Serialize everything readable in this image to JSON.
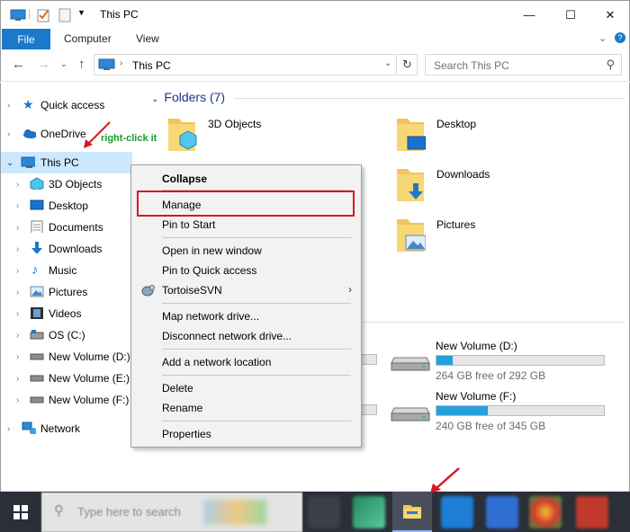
{
  "window": {
    "title": "This PC",
    "controls": {
      "minimize": "—",
      "maximize": "☐",
      "close": "✕"
    }
  },
  "ribbon": {
    "tabs": [
      "File",
      "Computer",
      "View"
    ],
    "collapse_chevron": "⌄",
    "help": "?"
  },
  "address": {
    "path": "This PC",
    "search_placeholder": "Search This PC"
  },
  "navigation": {
    "quick_access": "Quick access",
    "onedrive": "OneDrive",
    "this_pc": "This PC",
    "children": [
      {
        "label": "3D Objects",
        "icon": "3d-objects-icon"
      },
      {
        "label": "Desktop",
        "icon": "desktop-icon"
      },
      {
        "label": "Documents",
        "icon": "documents-icon"
      },
      {
        "label": "Downloads",
        "icon": "downloads-icon"
      },
      {
        "label": "Music",
        "icon": "music-icon"
      },
      {
        "label": "Pictures",
        "icon": "pictures-icon"
      },
      {
        "label": "Videos",
        "icon": "videos-icon"
      },
      {
        "label": "OS (C:)",
        "icon": "drive-icon"
      },
      {
        "label": "New Volume (D:)",
        "icon": "drive-icon"
      },
      {
        "label": "New Volume (E:)",
        "icon": "drive-icon"
      },
      {
        "label": "New Volume (F:)",
        "icon": "drive-icon"
      }
    ],
    "network": "Network"
  },
  "content": {
    "folders_header": "Folders (7)",
    "folders": [
      {
        "label": "3D Objects",
        "overlay": "3d-cube"
      },
      {
        "label": "Desktop",
        "overlay": "desktop"
      },
      {
        "label": "Downloads",
        "overlay": "download-arrow"
      },
      {
        "label": "Pictures",
        "overlay": "picture"
      }
    ],
    "drives": [
      {
        "label": "New Volume (D:)",
        "free": "264 GB free of 292 GB",
        "used_fraction": 0.096
      },
      {
        "label": "New Volume (F:)",
        "free": "240 GB free of 345 GB",
        "used_fraction": 0.304
      }
    ]
  },
  "context_menu": {
    "items": [
      {
        "label": "Collapse",
        "bold": true
      },
      {
        "label": "Manage",
        "highlighted": true
      },
      {
        "label": "Pin to Start"
      },
      {
        "label": "Open in new window"
      },
      {
        "label": "Pin to Quick access"
      },
      {
        "label": "TortoiseSVN",
        "submenu": true
      },
      {
        "label": "Map network drive..."
      },
      {
        "label": "Disconnect network drive..."
      },
      {
        "label": "Add a network location"
      },
      {
        "label": "Delete"
      },
      {
        "label": "Rename"
      },
      {
        "label": "Properties"
      }
    ]
  },
  "annotation": {
    "text": "right-click it",
    "color": "#1a9a2c",
    "box_color": "#d71920"
  },
  "taskbar": {
    "search_placeholder": "Type here to search"
  },
  "colors": {
    "accent": "#1979ca",
    "selection": "#cce8ff",
    "drive_fill": "#26a0da",
    "folders_header": "#1e3287"
  }
}
